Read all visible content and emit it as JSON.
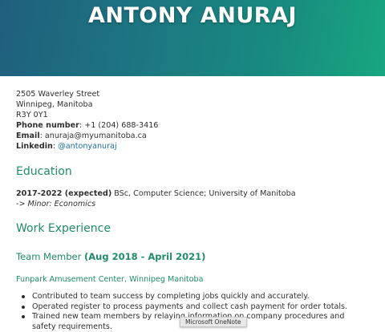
{
  "header": {
    "name": "ANTONY ANURAJ"
  },
  "contact": {
    "street": "2505 Waverley Street",
    "city": "Winnipeg, Manitoba",
    "postal": "R3Y 0Y1",
    "phone_label": "Phone number",
    "phone_value": ": +1 (204) 688-3416",
    "email_label": "Email",
    "email_value": ": anuraja@myumanitoba.ca",
    "linkedin_label": "Linkedin",
    "linkedin_sep": ": ",
    "linkedin_value": "@antonyanuraj"
  },
  "education": {
    "title": "Education",
    "years": "2017-2022 (expected)",
    "degree": " BSc, Computer Science; University of Manitoba",
    "minor": "-> Minor: Economics"
  },
  "work": {
    "title": "Work Experience",
    "job_title": "Team Member ",
    "job_dates": "(Aug 2018 - April 2021)",
    "employer": "Funpark Amusement Center, Winnipeg Manitoba",
    "duties": [
      "Contributed to team success by completing jobs quickly and accurately.",
      "Operated register to process payments and collect cash payment for order totals.",
      "Trained new team members by relaying information on company procedures and safety requirements."
    ]
  },
  "tooltip": {
    "text": "Microsoft OneNote"
  },
  "colors": {
    "accent": "#1f8a6c",
    "link": "#1e6f9c",
    "header_start": "#1f5f7e",
    "header_end": "#18a67f"
  }
}
